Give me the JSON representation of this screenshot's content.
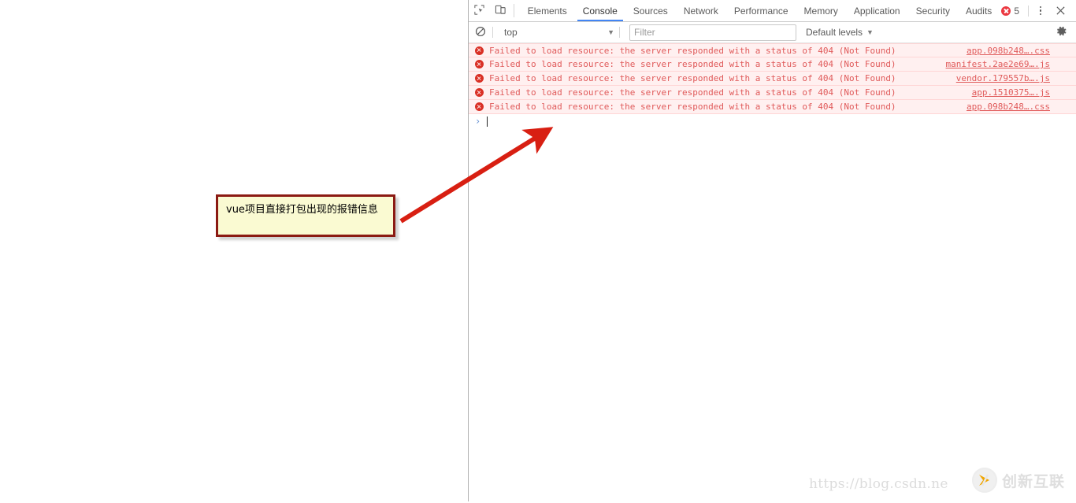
{
  "window": {
    "page_area_label": "blank-page",
    "splitter_label": "devtools-splitter"
  },
  "devtools": {
    "toolbar": {
      "inspect_icon": "inspect-element-icon",
      "device_icon": "device-toolbar-icon",
      "tabs": [
        {
          "label": "Elements",
          "active": false
        },
        {
          "label": "Console",
          "active": true
        },
        {
          "label": "Sources",
          "active": false
        },
        {
          "label": "Network",
          "active": false
        },
        {
          "label": "Performance",
          "active": false
        },
        {
          "label": "Memory",
          "active": false
        },
        {
          "label": "Application",
          "active": false
        },
        {
          "label": "Security",
          "active": false
        },
        {
          "label": "Audits",
          "active": false
        }
      ],
      "error_count": "5",
      "more_tools_icon": "vertical-dots-icon",
      "close_icon": "close-icon",
      "active_tab_underline_color": "#4285f4",
      "error_badge_color": "#eb3941"
    },
    "filterbar": {
      "clear_icon": "clear-console-icon",
      "context_value": "top",
      "context_caret": "▼",
      "filter_placeholder": "Filter",
      "filter_value": "",
      "levels_value": "Default levels",
      "levels_caret": "▼",
      "settings_icon": "gear-icon"
    },
    "console": {
      "message_text": "Failed to load resource: the server responded with a status of 404 (Not Found)",
      "message_color": "#e05a5a",
      "row_background": "#fff0f0",
      "messages": [
        {
          "text": "Failed to load resource: the server responded with a status of 404 (Not Found)",
          "source": "app.098b248….css",
          "level": "error"
        },
        {
          "text": "Failed to load resource: the server responded with a status of 404 (Not Found)",
          "source": "manifest.2ae2e69….js",
          "level": "error"
        },
        {
          "text": "Failed to load resource: the server responded with a status of 404 (Not Found)",
          "source": "vendor.179557b….js",
          "level": "error"
        },
        {
          "text": "Failed to load resource: the server responded with a status of 404 (Not Found)",
          "source": "app.1510375….js",
          "level": "error"
        },
        {
          "text": "Failed to load resource: the server responded with a status of 404 (Not Found)",
          "source": "app.098b248….css",
          "level": "error"
        }
      ],
      "prompt_symbol": "›",
      "prompt_value": ""
    }
  },
  "annotation": {
    "text": "vue项目直接打包出现的报错信息",
    "border_color": "#8b1a13",
    "background_color": "#fafad2",
    "arrow_color": "#d81f12"
  },
  "watermark": {
    "url": "https://blog.csdn.ne",
    "logo_mark": "K",
    "brand": "创新互联"
  }
}
